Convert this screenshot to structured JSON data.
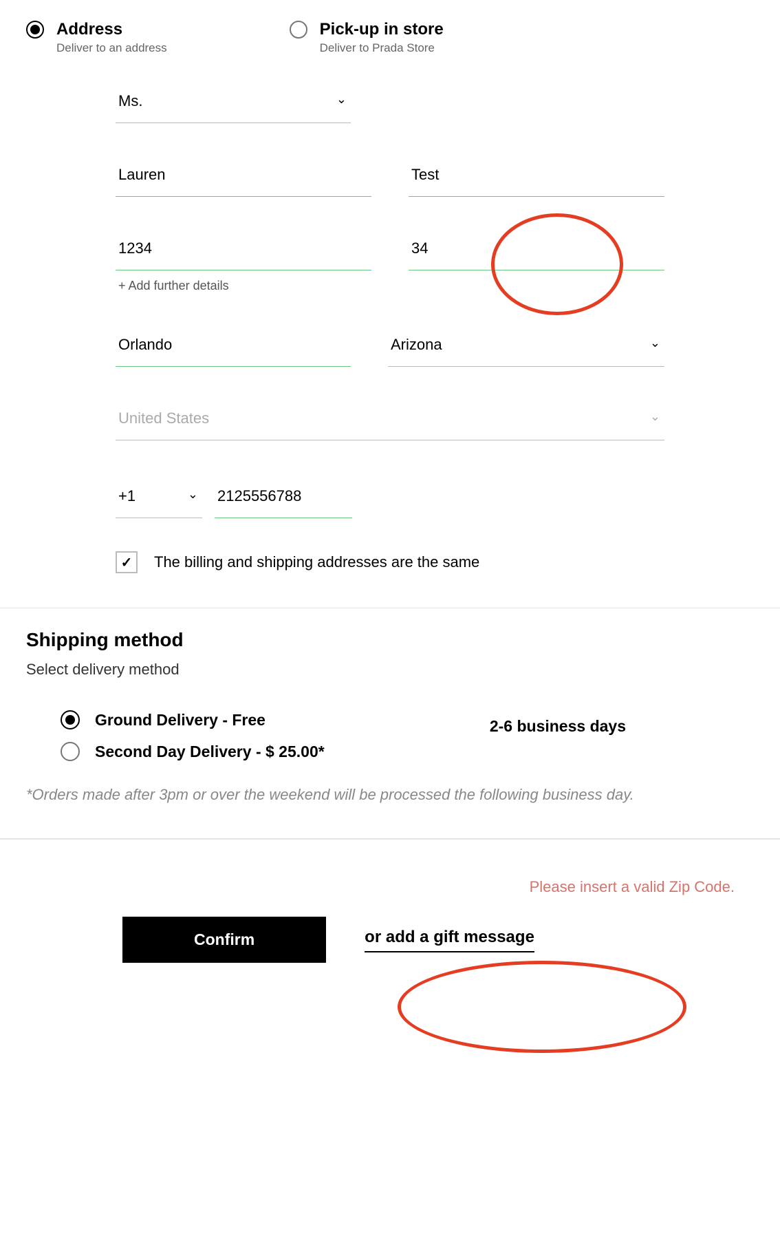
{
  "delivery": {
    "address": {
      "title": "Address",
      "sub": "Deliver to an address"
    },
    "pickup": {
      "title": "Pick-up in store",
      "sub": "Deliver to Prada Store"
    }
  },
  "form": {
    "salutation": "Ms.",
    "first_name": "Lauren",
    "last_name": "Test",
    "street": "1234",
    "apt": "34",
    "add_details": "+ Add further details",
    "city": "Orlando",
    "state": "Arizona",
    "country": "United States",
    "phone_code": "+1",
    "phone": "2125556788",
    "same_billing_label": "The billing and shipping addresses are the same"
  },
  "shipping": {
    "title": "Shipping method",
    "sub": "Select delivery method",
    "options": [
      {
        "label": "Ground Delivery - Free",
        "time": "2-6 business days"
      },
      {
        "label": "Second Day Delivery - $ 25.00*",
        "time": ""
      }
    ],
    "note": "*Orders made after 3pm or over the weekend will be processed the following business day."
  },
  "bottom": {
    "error": "Please insert a valid Zip Code.",
    "confirm": "Confirm",
    "gift": "or add a gift message"
  }
}
